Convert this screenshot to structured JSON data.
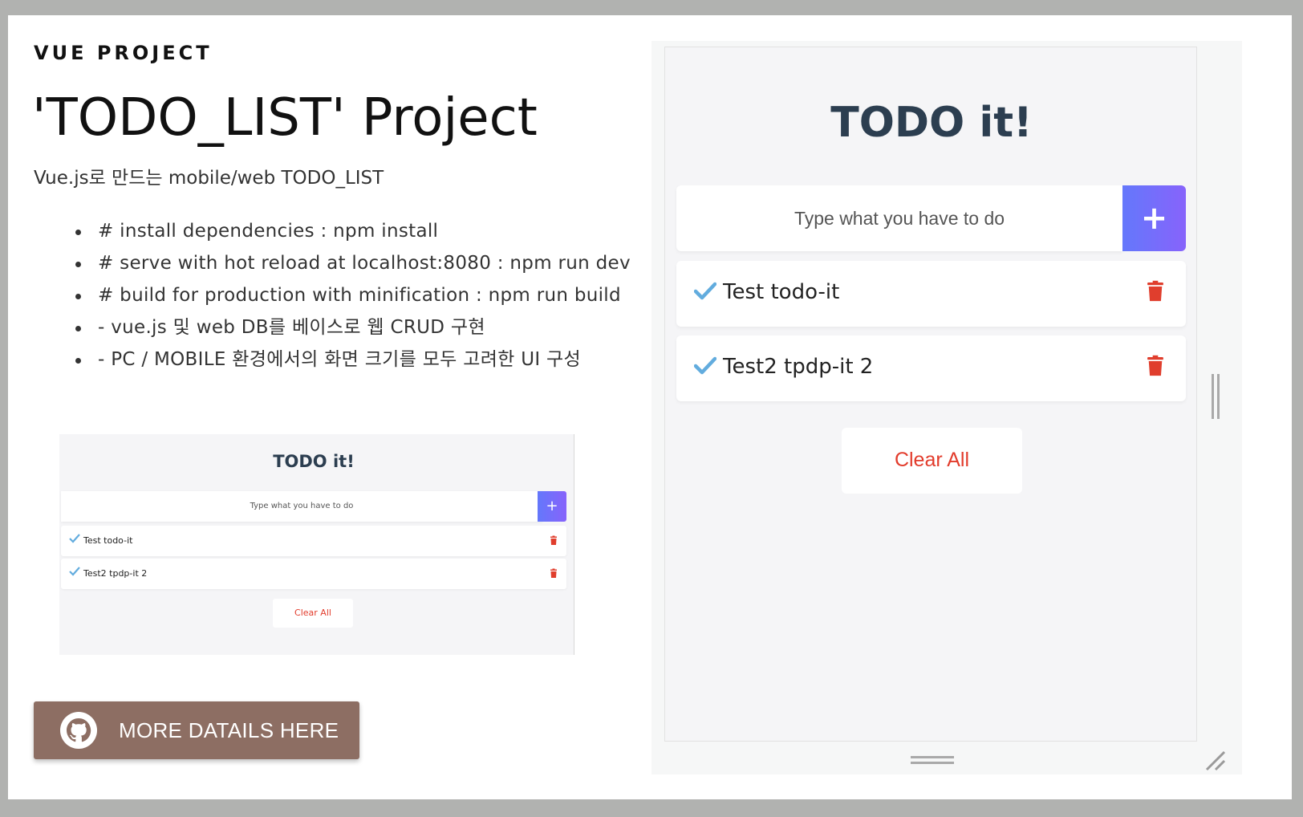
{
  "section": {
    "eyebrow": "VUE PROJECT",
    "title": "'TODO_LIST' Project",
    "subtitle": "Vue.js로 만드는 mobile/web TODO_LIST",
    "bullets": [
      "# install dependencies : npm install",
      "# serve with hot reload at localhost:8080 : npm run dev",
      "# build for production with minification : npm run build",
      "- vue.js 및 web DB를 베이스로 웹 CRUD 구현",
      "- PC / MOBILE 환경에서의 화면 크기를 모두 고려한 UI 구성"
    ],
    "github_button": {
      "label": "MORE DATAILS HERE",
      "icon": "github-icon"
    }
  },
  "app": {
    "title": "TODO it!",
    "input_placeholder": "Type what you have to do",
    "add_symbol": "+",
    "todos": [
      {
        "text": "Test todo-it",
        "icon": "check-icon"
      },
      {
        "text": "Test2 tpdp-it 2",
        "icon": "check-icon"
      }
    ],
    "clear_label": "Clear All"
  },
  "thumbnail": {
    "title": "TODO it!",
    "input_placeholder": "Type what you have to do",
    "add_symbol": "+",
    "todos": [
      {
        "text": "Test todo-it"
      },
      {
        "text": "Test2 tpdp-it 2"
      }
    ],
    "clear_label": "Clear All"
  },
  "colors": {
    "background": "#b1b2b0",
    "github_button": "#8d6e63",
    "add_gradient_start": "#6478fb",
    "add_gradient_end": "#8763fb",
    "check": "#62acde",
    "trash": "#e03e2d",
    "clear_text": "#e23b2b",
    "app_title": "#2c3e50"
  }
}
